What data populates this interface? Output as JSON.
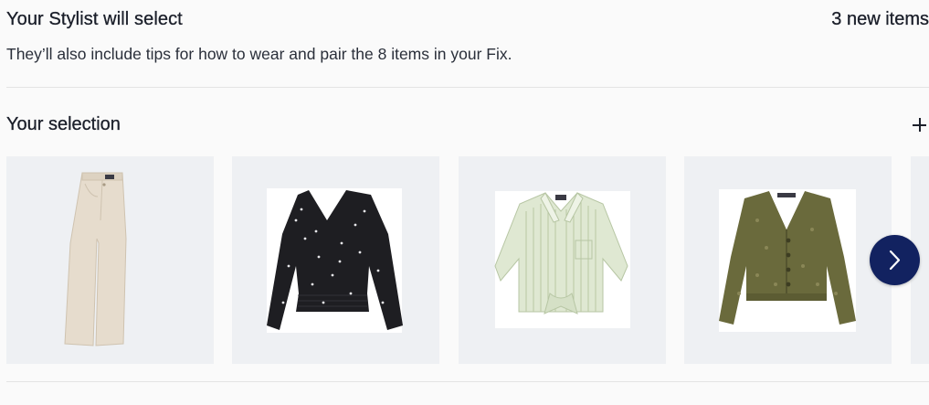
{
  "stylist": {
    "title": "Your Stylist will select",
    "count": "3 new items",
    "description": "They’ll also include tips for how to wear and pair the 8 items in your Fix."
  },
  "selection": {
    "title": "Your selection",
    "add_icon": "plus-icon",
    "next_icon": "chevron-right-icon",
    "items": [
      {
        "name": "flare-pants",
        "color": "#e6dccd"
      },
      {
        "name": "floral-blouse",
        "color": "#1e1e22"
      },
      {
        "name": "striped-shirt",
        "color": "#dfe8d2"
      },
      {
        "name": "cardigan",
        "color": "#6a6a3c"
      }
    ]
  },
  "colors": {
    "accent": "#122260",
    "card_background": "#eef0f3"
  }
}
